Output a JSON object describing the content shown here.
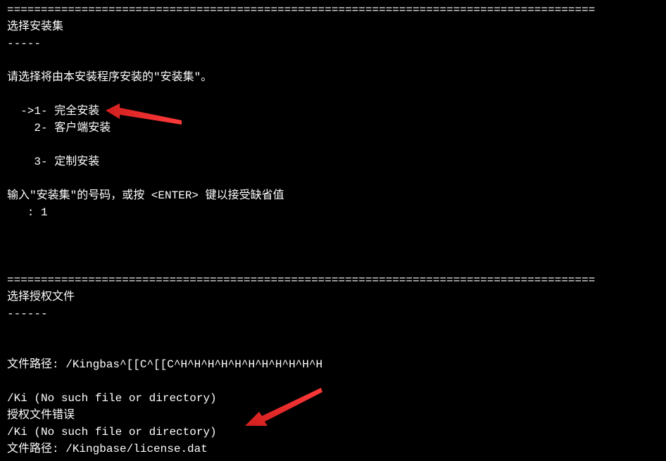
{
  "section1": {
    "divider": "=======================================================================================",
    "title": "选择安装集",
    "dashes": "-----",
    "prompt": "请选择将由本安装程序安装的\"安装集\"。",
    "options": [
      {
        "marker": "  ->1-",
        "label": "完全安装"
      },
      {
        "marker": "    2-",
        "label": "客户端安装"
      },
      {
        "marker": "    3-",
        "label": "定制安装"
      }
    ],
    "inputPrompt": "输入\"安装集\"的号码，或按 <ENTER> 键以接受缺省值",
    "inputLine": "   : 1"
  },
  "section2": {
    "divider": "=======================================================================================",
    "title": "选择授权文件",
    "dashes": "------",
    "pathLabel1": "文件路径:",
    "pathValue1": "/Kingbas^[[C^[[C^H^H^H^H^H^H^H^H^H^H^H",
    "errorLine1": "/Ki (No such file or directory)",
    "errorMsg": "授权文件错误",
    "errorLine2": "/Ki (No such file or directory)",
    "pathLabel2": "文件路径:",
    "pathValue2": "/Kingbase/license.dat"
  }
}
